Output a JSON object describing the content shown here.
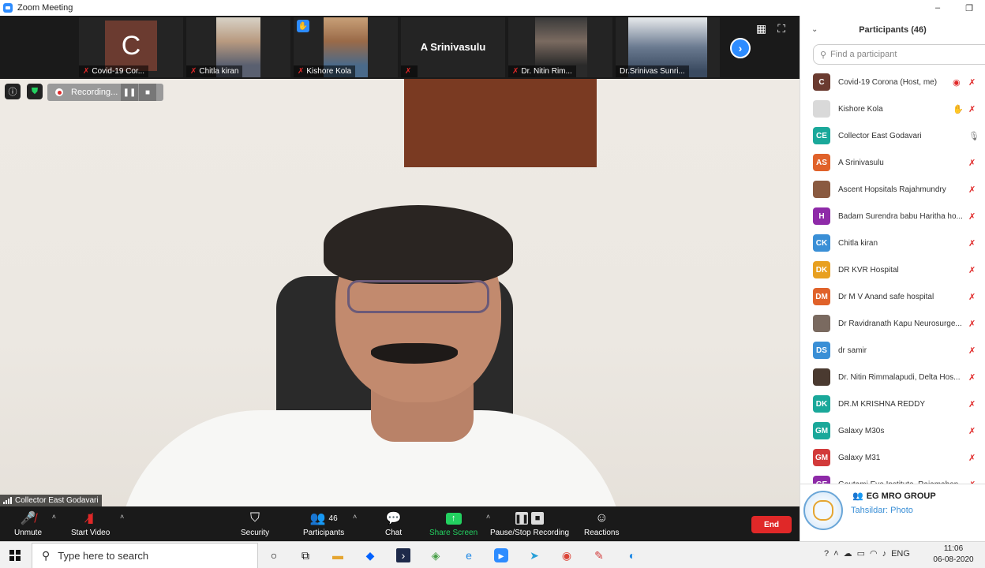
{
  "window": {
    "title": "Zoom Meeting",
    "minimize": "–",
    "maximize": "❐"
  },
  "thumbnails": [
    {
      "name": "Covid-19 Cor...",
      "avatar": "C"
    },
    {
      "name": "Chitla kiran"
    },
    {
      "name": "Kishore Kola"
    },
    {
      "name": "",
      "big_name": "A Srinivasulu"
    },
    {
      "name": "Dr. Nitin Rim..."
    },
    {
      "name": "Dr.Srinivas Sunri..."
    }
  ],
  "video": {
    "recording_label": "Recording...",
    "speaker_name": "Collector East Godavari"
  },
  "toolbar": {
    "unmute": "Unmute",
    "start_video": "Start Video",
    "security": "Security",
    "participants": "Participants",
    "participants_count": "46",
    "chat": "Chat",
    "share_screen": "Share Screen",
    "recording": "Pause/Stop Recording",
    "reactions": "Reactions",
    "end": "End"
  },
  "panel": {
    "title": "Participants (46)",
    "search_placeholder": "Find a participant",
    "participants": [
      {
        "initials": "C",
        "name": "Covid-19 Corona (Host, me)",
        "color": "#6b3b30"
      },
      {
        "initials": "",
        "name": "Kishore Kola",
        "color": "#d9d9d9"
      },
      {
        "initials": "CE",
        "name": "Collector East Godavari",
        "color": "#1aa89a"
      },
      {
        "initials": "AS",
        "name": "A Srinivasulu",
        "color": "#e0622a"
      },
      {
        "initials": "",
        "name": "Ascent Hopsitals Rajahmundry",
        "color": "#8a5a40"
      },
      {
        "initials": "H",
        "name": "Badam Surendra babu Haritha ho...",
        "color": "#8e2aa8"
      },
      {
        "initials": "CK",
        "name": "Chitla kiran",
        "color": "#3a8fd6"
      },
      {
        "initials": "DK",
        "name": "DR KVR Hospital",
        "color": "#e8a020"
      },
      {
        "initials": "DM",
        "name": "Dr M V Anand safe hospital",
        "color": "#e0622a"
      },
      {
        "initials": "",
        "name": "Dr Ravidranath Kapu Neurosurge...",
        "color": "#7a6a60"
      },
      {
        "initials": "DS",
        "name": "dr samir",
        "color": "#3a8fd6"
      },
      {
        "initials": "",
        "name": "Dr. Nitin Rimmalapudi, Delta Hos...",
        "color": "#4a3a30"
      },
      {
        "initials": "DK",
        "name": "DR.M KRISHNA REDDY",
        "color": "#1aa89a"
      },
      {
        "initials": "GM",
        "name": "Galaxy M30s",
        "color": "#1aa89a"
      },
      {
        "initials": "GM",
        "name": "Galaxy M31",
        "color": "#d23a3a"
      },
      {
        "initials": "GE",
        "name": "Goutami Eye Institute, Rajamahen...",
        "color": "#8e2aa8"
      }
    ]
  },
  "group_card": {
    "name": "EG MRO GROUP",
    "subtitle": "Tahsildar: Photo"
  },
  "taskbar": {
    "search_placeholder": "Type here to search",
    "language": "ENG",
    "time": "11:06",
    "date": "06-08-2020"
  }
}
